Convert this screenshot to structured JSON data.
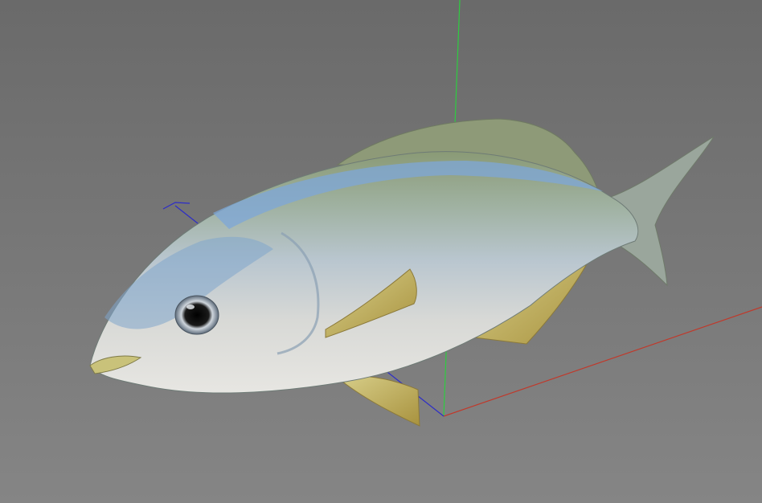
{
  "viewport": {
    "background_top": "#6a6a6a",
    "background_bottom": "#858585"
  },
  "axes": {
    "x_color": "#c0392b",
    "y_color": "#2ecc40",
    "z_color": "#2c2cc8"
  },
  "fish": {
    "back_color": "#7f8f7a",
    "stripe_color": "#7ea7d8",
    "belly_color": "#d9d9d4",
    "fin_color": "#c9b46a",
    "eye_color": "#111111"
  }
}
